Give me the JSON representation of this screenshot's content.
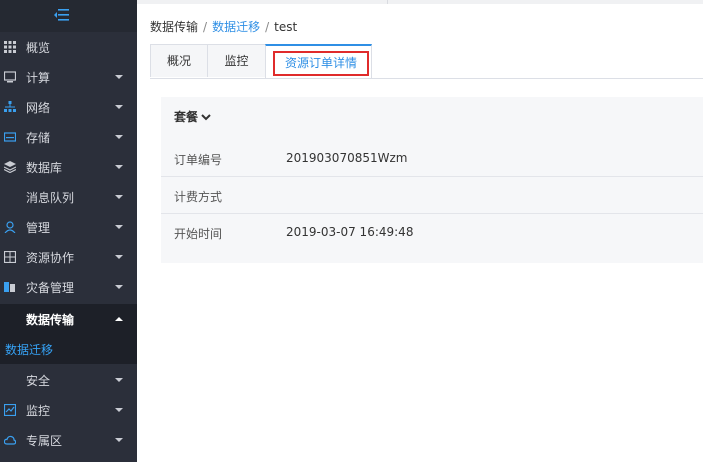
{
  "sidebar": {
    "items": [
      {
        "label": "概览",
        "icon": "grid-icon",
        "expandable": false
      },
      {
        "label": "计算",
        "icon": "monitor-icon",
        "expandable": true
      },
      {
        "label": "网络",
        "icon": "network-icon",
        "expandable": true
      },
      {
        "label": "存储",
        "icon": "storage-icon",
        "expandable": true
      },
      {
        "label": "数据库",
        "icon": "layers-icon",
        "expandable": true
      },
      {
        "label": "消息队列",
        "icon": "",
        "expandable": true
      },
      {
        "label": "管理",
        "icon": "user-icon",
        "expandable": true
      },
      {
        "label": "资源协作",
        "icon": "share-icon",
        "expandable": true
      },
      {
        "label": "灾备管理",
        "icon": "backup-icon",
        "expandable": true
      },
      {
        "label": "数据传输",
        "icon": "",
        "expandable": true,
        "open": true
      },
      {
        "label": "安全",
        "icon": "",
        "expandable": true
      },
      {
        "label": "监控",
        "icon": "chart-icon",
        "expandable": true
      },
      {
        "label": "专属区",
        "icon": "cloud-icon",
        "expandable": true
      }
    ],
    "active_sub": "数据迁移"
  },
  "breadcrumb": {
    "level1": "数据传输",
    "level2": "数据迁移",
    "level3": "test",
    "separator": "/"
  },
  "tabs": [
    {
      "label": "概况"
    },
    {
      "label": "监控"
    },
    {
      "label": "资源订单详情",
      "active": true
    }
  ],
  "panel": {
    "title": "套餐",
    "rows": [
      {
        "key": "订单编号",
        "value": "201903070851Wzm"
      },
      {
        "key": "计费方式",
        "value": ""
      },
      {
        "key": "开始时间",
        "value": "2019-03-07 16:49:48"
      }
    ]
  },
  "colors": {
    "sidebar_bg": "#2b2f3a",
    "accent_blue": "#2f8fe5",
    "highlight_red": "#e02b2b"
  }
}
